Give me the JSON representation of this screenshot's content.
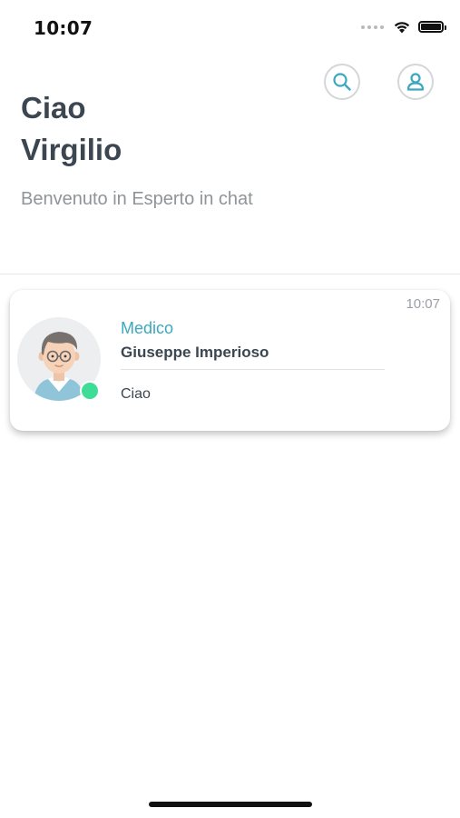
{
  "status_bar": {
    "time": "10:07",
    "icons": [
      "signal-icon",
      "wifi-icon",
      "battery-icon"
    ]
  },
  "header": {
    "actions": [
      "search-icon",
      "profile-icon"
    ],
    "greeting_line1": "Ciao",
    "greeting_line2": "Virgilio",
    "subtitle": "Benvenuto in Esperto in chat"
  },
  "chats": [
    {
      "role": "Medico",
      "name": "Giuseppe Imperioso",
      "last_message": "Ciao",
      "time": "10:07",
      "online": true
    }
  ],
  "colors": {
    "accent": "#3aa9bf",
    "text_dark": "#3b4651",
    "text_muted": "#8f9499",
    "online": "#3ddc97"
  }
}
